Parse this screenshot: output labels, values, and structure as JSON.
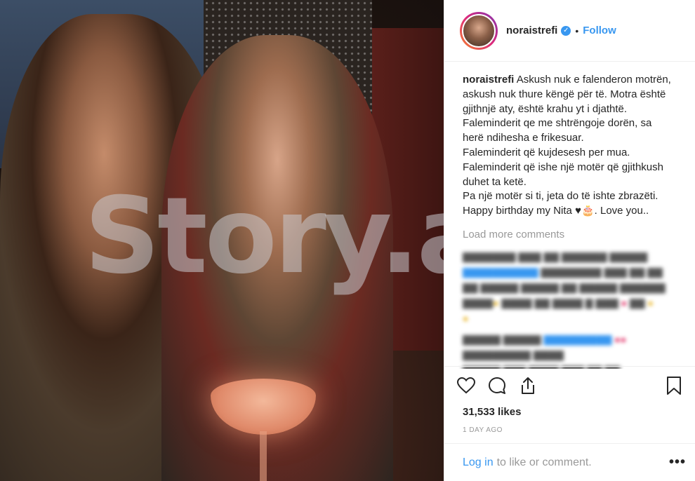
{
  "post": {
    "username": "noraistrefi",
    "follow_label": "Follow",
    "separator": "•",
    "caption_lines": [
      "Askush nuk e falenderon motrën,",
      "askush nuk thure këngë për të. Motra është",
      "gjithnjë aty, është krahu yt i djathtë.",
      "Faleminderit qe me shtrëngoje dorën, sa",
      "herë ndihesha e frikesuar.",
      "Faleminderit që kujdesesh per mua.",
      "Faleminderit që ishe një motër që gjithkush",
      "duhet ta ketë.",
      "Pa një motër si ti, jeta do të ishte zbrazëti.",
      "Happy birthday my Nita ♥🎂. Love you.."
    ],
    "load_more": "Load more comments",
    "likes": "31,533 likes",
    "time": "1 DAY AGO"
  },
  "watermark": "Story.al",
  "login": {
    "link": "Log in",
    "rest": "to like or comment.",
    "more": "•••"
  },
  "icons": {
    "like": "heart-icon",
    "comment": "comment-icon",
    "share": "share-icon",
    "save": "bookmark-icon",
    "verified": "verified-badge-icon"
  },
  "colors": {
    "accent": "#3897f0",
    "muted": "#999999",
    "text": "#262626"
  }
}
